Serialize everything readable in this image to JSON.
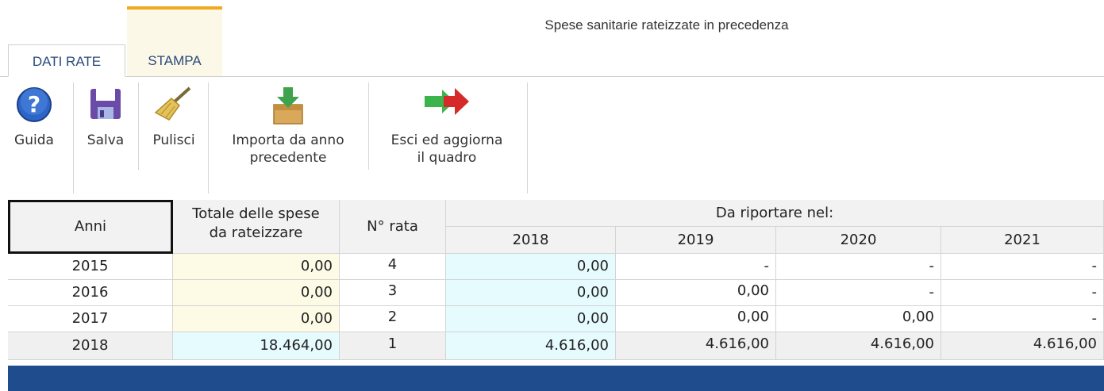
{
  "window": {
    "title": "Spese sanitarie rateizzate in precedenza"
  },
  "tabs": [
    {
      "label": "DATI RATE",
      "active": true
    },
    {
      "label": "STAMPA",
      "active": false
    }
  ],
  "ribbon": {
    "guida": {
      "label": "Guida",
      "icon": "help-icon"
    },
    "salva": {
      "label": "Salva",
      "icon": "floppy-save-icon"
    },
    "pulisci": {
      "label": "Pulisci",
      "icon": "broom-icon"
    },
    "importa": {
      "label": "Importa da anno\nprecedente",
      "icon": "import-box-icon"
    },
    "esci": {
      "label": "Esci ed aggiorna\nil quadro",
      "icon": "exit-arrow-icon"
    }
  },
  "table": {
    "headers": {
      "anni": "Anni",
      "totale": "Totale delle spese\nda rateizzare",
      "rata": "N° rata",
      "da_riportare": "Da riportare nel:",
      "years": [
        "2018",
        "2019",
        "2020",
        "2021"
      ]
    },
    "rows": [
      {
        "anno": "2015",
        "totale": "0,00",
        "rata": "4",
        "y2018": "0,00",
        "y2019": "-",
        "y2020": "-",
        "y2021": "-"
      },
      {
        "anno": "2016",
        "totale": "0,00",
        "rata": "3",
        "y2018": "0,00",
        "y2019": "0,00",
        "y2020": "-",
        "y2021": "-"
      },
      {
        "anno": "2017",
        "totale": "0,00",
        "rata": "2",
        "y2018": "0,00",
        "y2019": "0,00",
        "y2020": "0,00",
        "y2021": "-"
      },
      {
        "anno": "2018",
        "totale": "18.464,00",
        "rata": "1",
        "y2018": "4.616,00",
        "y2019": "4.616,00",
        "y2020": "4.616,00",
        "y2021": "4.616,00"
      }
    ]
  },
  "colors": {
    "accent": "#f2a91d",
    "tab_text": "#2b4a7a",
    "bottom_bar": "#1e4c8c",
    "input_yellow": "#fdfbe6",
    "input_cyan": "#e6fbfd"
  }
}
